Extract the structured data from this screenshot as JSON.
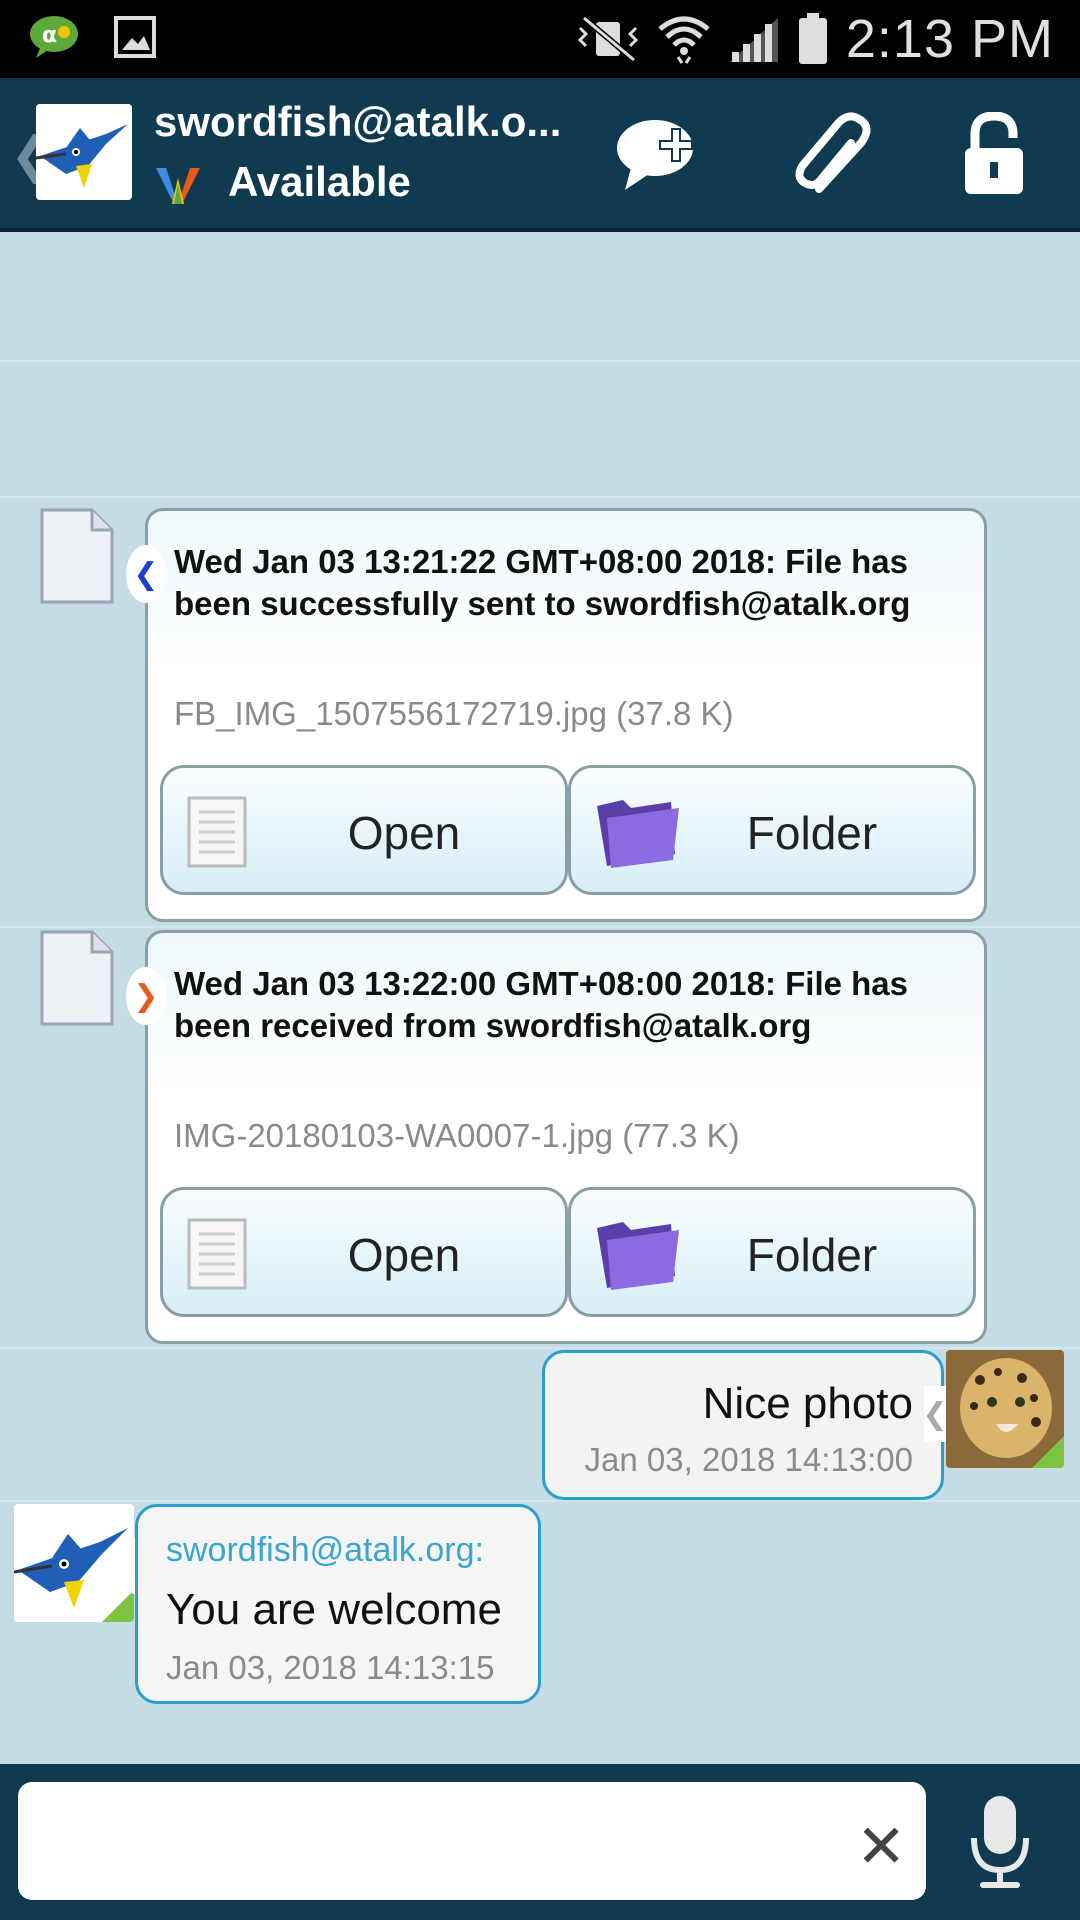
{
  "status_bar": {
    "time": "2:13 PM"
  },
  "header": {
    "contact_name": "swordfish@atalk.o...",
    "presence": "Available"
  },
  "messages": [
    {
      "type": "file",
      "direction": "sent",
      "title": "Wed Jan 03 13:21:22 GMT+08:00 2018: File has been successfully sent to swordfish@atalk.org",
      "file_name": "FB_IMG_1507556172719.jpg (37.8 K)",
      "open_label": "Open",
      "folder_label": "Folder"
    },
    {
      "type": "file",
      "direction": "received",
      "title": "Wed Jan 03 13:22:00 GMT+08:00 2018: File has been received from swordfish@atalk.org",
      "file_name": "IMG-20180103-WA0007-1.jpg (77.3 K)",
      "open_label": "Open",
      "folder_label": "Folder"
    },
    {
      "type": "text",
      "direction": "sent",
      "text": "Nice photo",
      "timestamp": "Jan 03, 2018 14:13:00"
    },
    {
      "type": "text",
      "direction": "received",
      "sender": "swordfish@atalk.org:",
      "text": "You are welcome",
      "timestamp": "Jan 03, 2018 14:13:15"
    }
  ],
  "input": {
    "value": "",
    "clear_glyph": "✕"
  },
  "colors": {
    "background": "#c4dde5",
    "action_bar": "#103a4f",
    "bubble_border": "#2c9fc9",
    "sent_arrow": "#1a3fd0",
    "received_arrow": "#e8591a"
  }
}
